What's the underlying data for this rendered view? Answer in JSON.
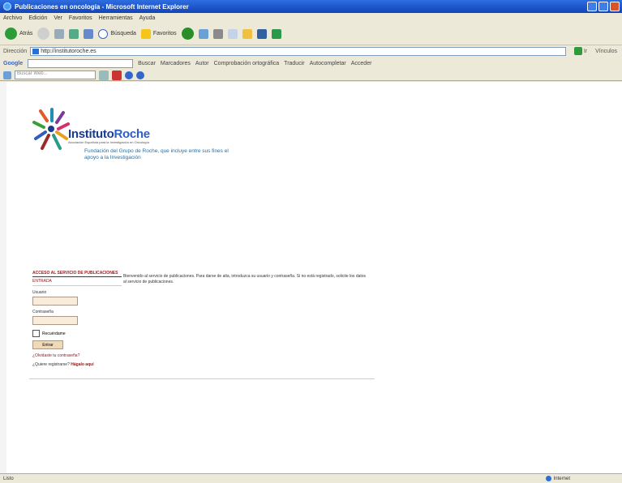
{
  "window": {
    "title": "Publicaciones en oncología - Microsoft Internet Explorer"
  },
  "menu": [
    "Archivo",
    "Edición",
    "Ver",
    "Favoritos",
    "Herramientas",
    "Ayuda"
  ],
  "toolbar": {
    "back": "Atrás",
    "search": "Búsqueda",
    "favorites": "Favoritos"
  },
  "address": {
    "label": "Dirección",
    "url": "http://institutoroche.es",
    "go": "Ir",
    "links": "Vínculos"
  },
  "google": {
    "logo": "Google",
    "search": "Buscar",
    "items": [
      "Marcadores",
      "Autor",
      "Comprobación ortográfica",
      "Traducir",
      "Autocompletar",
      "Acceder"
    ]
  },
  "searchbar": {
    "placeholder": "Buscar Web..."
  },
  "logo": {
    "brand1": "Instituto",
    "brand2": "Roche",
    "subtitle": "Asociación Española para la Investigación en Oncología",
    "tagline": "Fundación del Grupo de Roche, que incluye entre sus fines el apoyo a la Investigación"
  },
  "login": {
    "title": "ACCESO AL SERVICIO DE PUBLICACIONES",
    "subtitle": "ENTRADA",
    "user_label": "Usuario",
    "password_label": "Contraseña",
    "remember_label": "Recuérdame",
    "submit": "Entrar",
    "forgot": "¿Olvidaste tu contraseña?",
    "register_prefix": "¿Quiere registrarse?",
    "register_link": "Hágalo aquí"
  },
  "welcome": "Bienvenido al servicio de publicaciones. Para darse de alta, introduzca su usuario y contraseña. Si no está registrado, solicite los datos al servicio de publicaciones.",
  "status": {
    "left": "Listo",
    "zone": "Internet"
  },
  "colors": {
    "titlebar": "#1145B8",
    "accent": "#8b1a1a",
    "brand": "#1a3c8e"
  }
}
